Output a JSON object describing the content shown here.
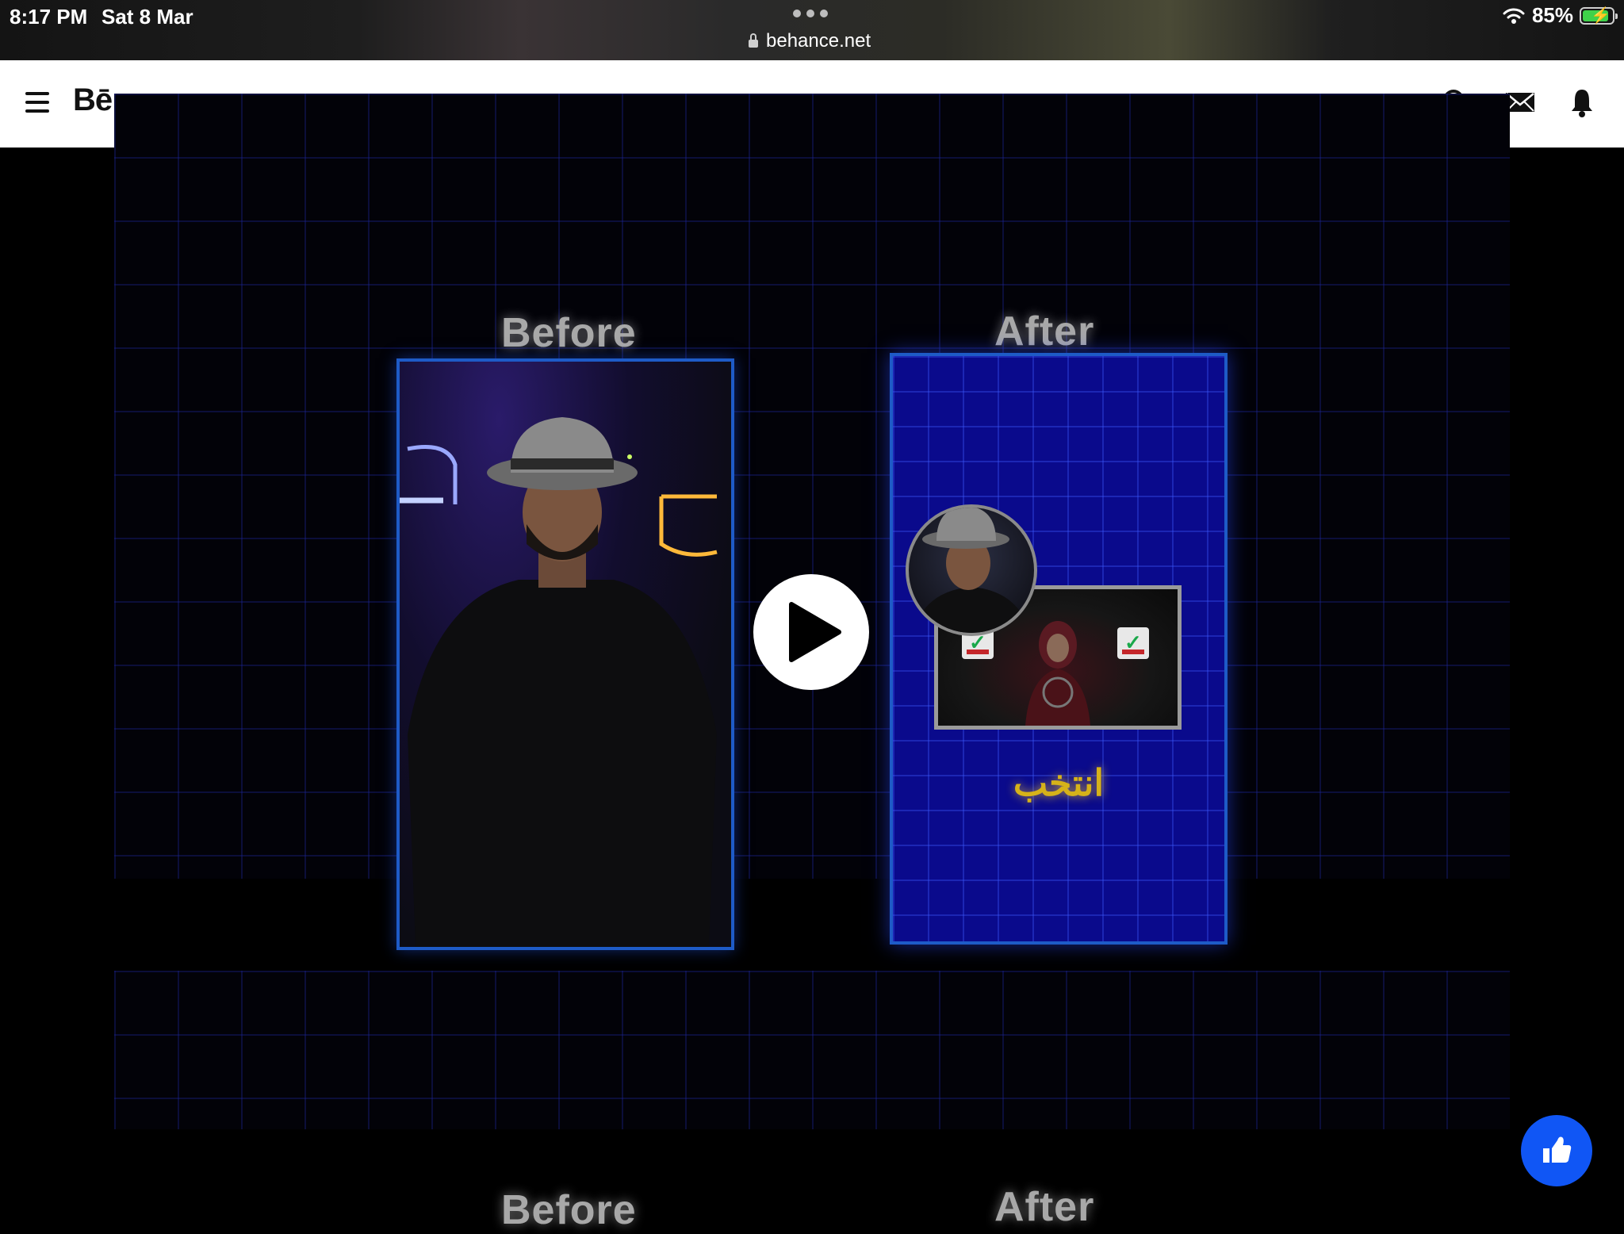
{
  "status_bar": {
    "time": "8:17 PM",
    "date": "Sat 8 Mar",
    "url": "behance.net",
    "battery": "85%"
  },
  "header": {
    "logo": "Bē",
    "icons": [
      "menu-icon",
      "search-icon",
      "mail-icon",
      "bell-icon"
    ]
  },
  "project": {
    "before_label": "Before",
    "after_label": "After",
    "after_caption": "انتخب",
    "second_before_label": "Before",
    "second_after_label": "After"
  },
  "colors": {
    "accent": "#1056f5",
    "frame_blue": "#1e5bc7",
    "caption_gold": "#d6b21a"
  }
}
